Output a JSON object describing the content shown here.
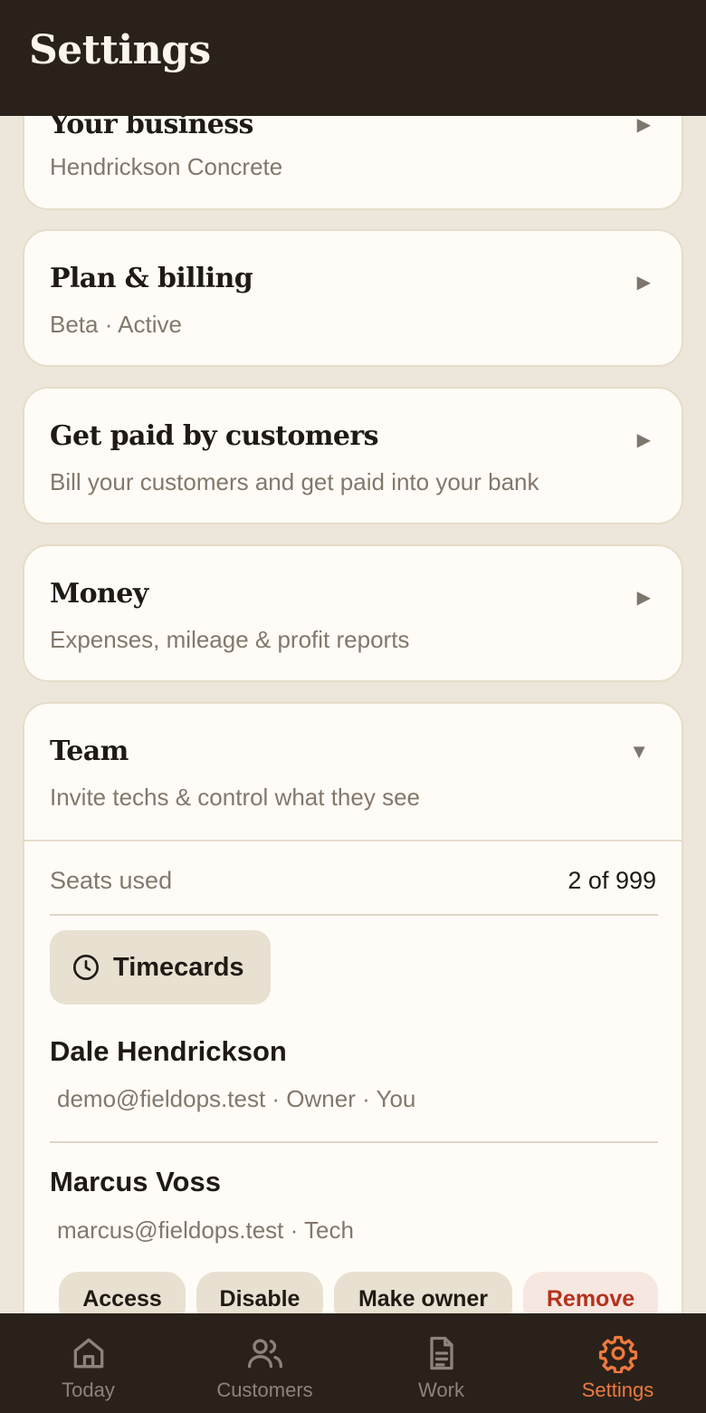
{
  "header": {
    "title": "Settings"
  },
  "cards": {
    "business": {
      "title": "Your business",
      "sub": "Hendrickson Concrete"
    },
    "plan": {
      "title": "Plan & billing",
      "sub": "Beta · Active"
    },
    "payments": {
      "title": "Get paid by customers",
      "sub": "Bill your customers and get paid into your bank"
    },
    "money": {
      "title": "Money",
      "sub": "Expenses, mileage & profit reports"
    },
    "team": {
      "title": "Team",
      "sub": "Invite techs & control what they see",
      "seats_label": "Seats used",
      "seats_value": "2 of 999",
      "timecards_label": "Timecards",
      "members": [
        {
          "name": "Dale Hendrickson",
          "meta": "demo@fieldops.test · Owner · You"
        },
        {
          "name": "Marcus Voss",
          "meta": "marcus@fieldops.test · Tech",
          "actions": [
            "Access",
            "Disable",
            "Make owner",
            "Remove"
          ]
        }
      ]
    }
  },
  "icons": {
    "collapsed": "▶",
    "expanded": "▼"
  },
  "tabs": [
    {
      "label": "Today",
      "icon": "home-icon"
    },
    {
      "label": "Customers",
      "icon": "users-icon"
    },
    {
      "label": "Work",
      "icon": "document-icon"
    },
    {
      "label": "Settings",
      "icon": "gear-icon",
      "active": true
    }
  ],
  "colors": {
    "accent": "#ee7a3e",
    "danger": "#b5321d",
    "header_bg": "#2a211b",
    "page_bg": "#ede6da"
  }
}
